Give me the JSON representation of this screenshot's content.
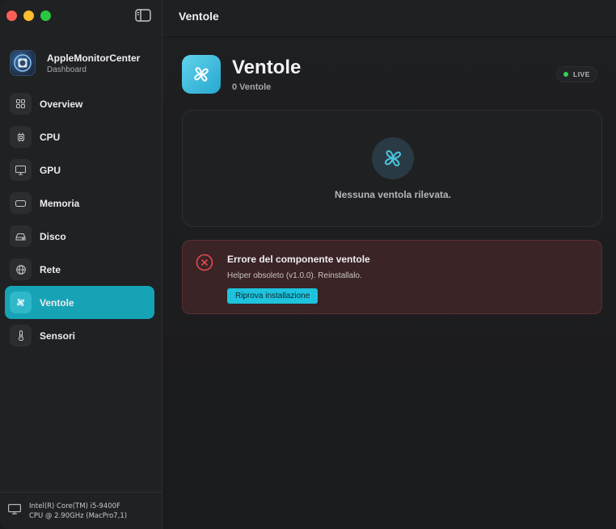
{
  "sidebar": {
    "app_name": "AppleMonitorCenter",
    "app_subtitle": "Dashboard",
    "items": [
      {
        "label": "Overview",
        "icon": "grid-icon",
        "active": false
      },
      {
        "label": "CPU",
        "icon": "cpu-chip-icon",
        "active": false
      },
      {
        "label": "GPU",
        "icon": "monitor-icon",
        "active": false
      },
      {
        "label": "Memoria",
        "icon": "memory-icon",
        "active": false
      },
      {
        "label": "Disco",
        "icon": "disk-icon",
        "active": false
      },
      {
        "label": "Rete",
        "icon": "globe-icon",
        "active": false
      },
      {
        "label": "Ventole",
        "icon": "fan-icon",
        "active": true
      },
      {
        "label": "Sensori",
        "icon": "thermometer-icon",
        "active": false
      }
    ],
    "footer": {
      "cpu_line1": "Intel(R) Core(TM) i5-9400F",
      "cpu_line2": "CPU @ 2.90GHz (MacPro7,1)"
    }
  },
  "topbar": {
    "title": "Ventole"
  },
  "page": {
    "title": "Ventole",
    "subtitle": "0 Ventole",
    "live_label": "LIVE",
    "empty_message": "Nessuna ventola rilevata.",
    "error": {
      "title": "Errore del componente ventole",
      "message": "Helper obsoleto (v1.0.0). Reinstallalo.",
      "button_label": "Riprova installazione"
    }
  },
  "colors": {
    "accent": "#16a3b6",
    "live": "#34d058",
    "error_border": "#5c2e30",
    "error_icon": "#e5484d"
  }
}
